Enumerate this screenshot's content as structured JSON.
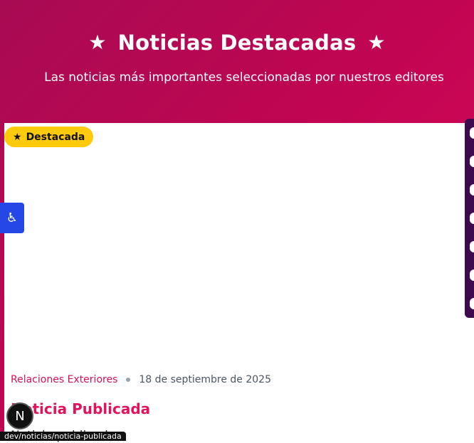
{
  "hero": {
    "title": "Noticias Destacadas",
    "subtitle": "Las noticias más importantes seleccionadas por nuestros editores",
    "star_left": "★",
    "star_right": "★"
  },
  "card": {
    "badge_label": "Destacada",
    "badge_icon": "★",
    "category": "Relaciones Exteriores",
    "date": "18 de septiembre de 2025",
    "title": "Noticia Publicada",
    "excerpt": "Noticia publicada"
  },
  "accessibility": {
    "icon": "♿"
  },
  "dev": {
    "nextjs_label": "N",
    "status_url": "dev/noticias/noticia-publicada"
  },
  "colors": {
    "hero_start": "#a80b53",
    "hero_end": "#dc0a5c",
    "badge": "#ffca0a",
    "accent": "#e1135f",
    "a11y": "#2447e6",
    "social_bar": "#3d0a4f"
  }
}
